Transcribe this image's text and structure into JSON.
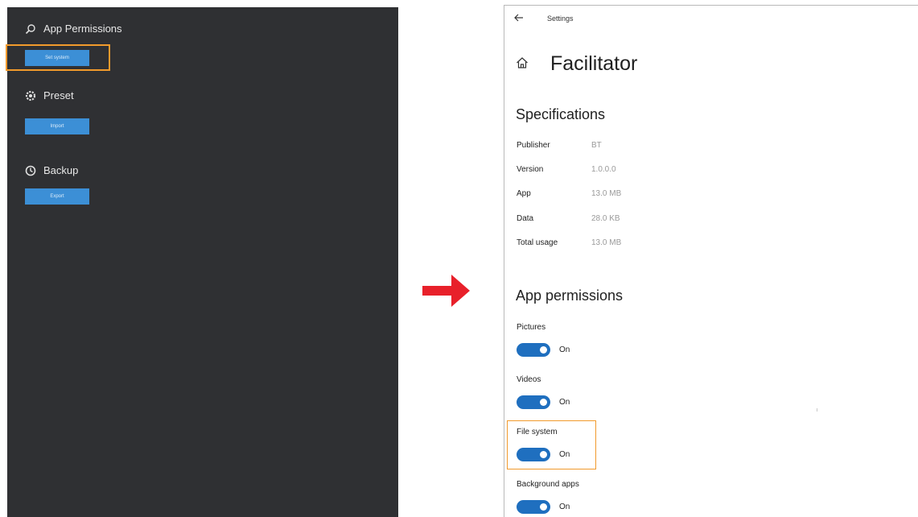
{
  "left": {
    "sections": [
      {
        "title": "App Permissions",
        "icon": "search-icon",
        "button": "Set system"
      },
      {
        "title": "Preset",
        "icon": "gear-icon",
        "button": "Import"
      },
      {
        "title": "Backup",
        "icon": "clock-icon",
        "button": "Export"
      }
    ]
  },
  "settings": {
    "window_title": "Settings",
    "app_name": "Facilitator",
    "specs_title": "Specifications",
    "specs": [
      {
        "label": "Publisher",
        "value": "BT"
      },
      {
        "label": "Version",
        "value": "1.0.0.0"
      },
      {
        "label": "App",
        "value": "13.0 MB"
      },
      {
        "label": "Data",
        "value": "28.0 KB"
      },
      {
        "label": "Total usage",
        "value": "13.0 MB"
      }
    ],
    "permissions_title": "App permissions",
    "permissions": [
      {
        "label": "Pictures",
        "state": "On"
      },
      {
        "label": "Videos",
        "state": "On"
      },
      {
        "label": "File system",
        "state": "On"
      },
      {
        "label": "Background apps",
        "state": "On"
      }
    ]
  },
  "colors": {
    "dark_panel": "#2f3033",
    "button_blue": "#3c8fd6",
    "toggle_blue": "#1f6fbf",
    "highlight_orange": "#f19a2c",
    "arrow_red": "#e8202a"
  }
}
